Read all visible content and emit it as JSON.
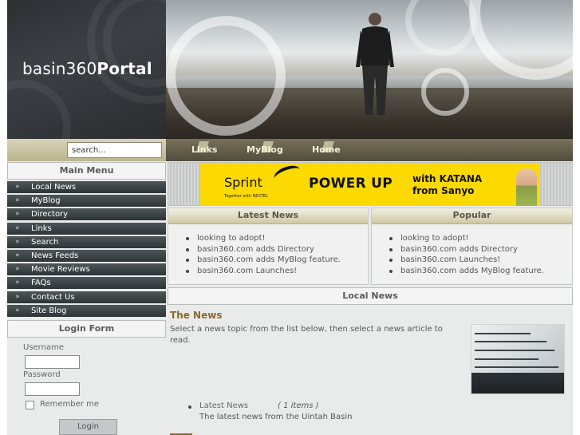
{
  "header": {
    "logo_regular": "basin360",
    "logo_bold": "Portal"
  },
  "search": {
    "value": "search..."
  },
  "topnav": {
    "items": [
      "Links",
      "MyBlog",
      "Home"
    ]
  },
  "main_menu": {
    "title": "Main Menu",
    "items": [
      "Local News",
      "MyBlog",
      "Directory",
      "Links",
      "Search",
      "News Feeds",
      "Movie Reviews",
      "FAQs",
      "Contact Us",
      "Site Blog"
    ]
  },
  "login_form": {
    "title": "Login Form",
    "username_label": "Username",
    "password_label": "Password",
    "remember_label": "Remember me",
    "login_button": "Login"
  },
  "ad": {
    "brand": "Sprint",
    "tagline": "Together with NEXTEL",
    "headline": "POWER UP",
    "offer_line1": "with KATANA",
    "offer_line2": "from Sanyo"
  },
  "latest_news": {
    "title": "Latest News",
    "items": [
      "looking to adopt!",
      "basin360.com adds Directory",
      "basin360.com adds MyBlog feature.",
      "basin360.com Launches!"
    ]
  },
  "popular": {
    "title": "Popular",
    "items": [
      "looking to adopt!",
      "basin360.com adds Directory",
      "basin360.com Launches!",
      "basin360.com adds MyBlog feature."
    ]
  },
  "local_news": {
    "bar_title": "Local News",
    "heading": "The News",
    "intro": "Select a news topic from the list below, then select a news article to read.",
    "topic_link": "Latest News",
    "topic_count": "( 1 items )",
    "topic_desc": "The latest news from the Uintah Basin"
  },
  "colors": {
    "menu_bg": "#3a4244",
    "nav_gold": "#bdb48c",
    "heading_brown": "#8a6a2c",
    "ad_yellow": "#fcd900"
  }
}
